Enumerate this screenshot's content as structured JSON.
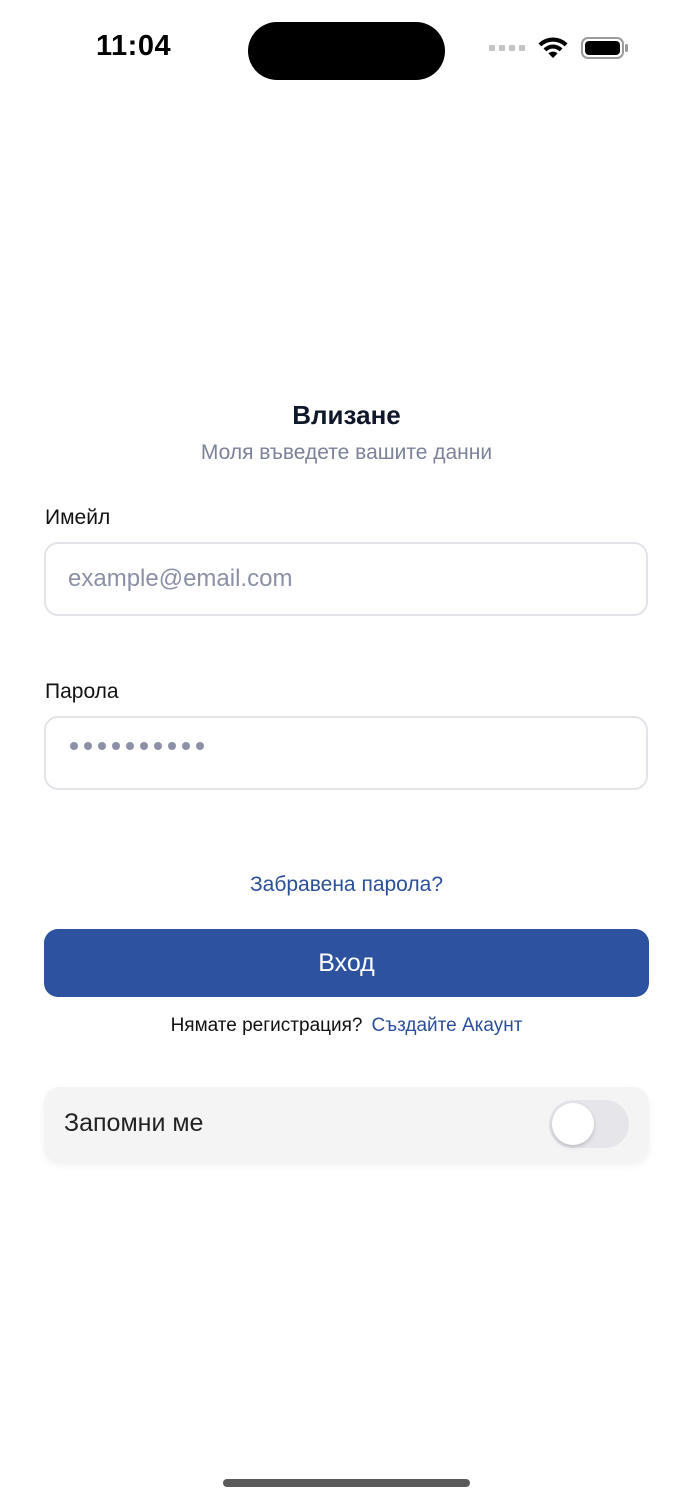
{
  "status_bar": {
    "time": "11:04"
  },
  "header": {
    "title": "Влизане",
    "subtitle": "Моля въведете вашите данни"
  },
  "email": {
    "label": "Имейл",
    "placeholder": "example@email.com",
    "value": ""
  },
  "password": {
    "label": "Парола",
    "masked_length": 10
  },
  "forgot_password_link": "Забравена парола?",
  "login_button_label": "Вход",
  "register": {
    "prompt": "Нямате регистрация?",
    "link": "Създайте Акаунт"
  },
  "remember_me": {
    "label": "Запомни ме",
    "enabled": false
  },
  "icons": {
    "wifi": "wifi-icon",
    "battery": "battery-icon"
  },
  "colors": {
    "accent": "#2c52a0",
    "link": "#2c4f99",
    "placeholder": "#8b90a6",
    "card_bg": "#f4f4f5"
  }
}
